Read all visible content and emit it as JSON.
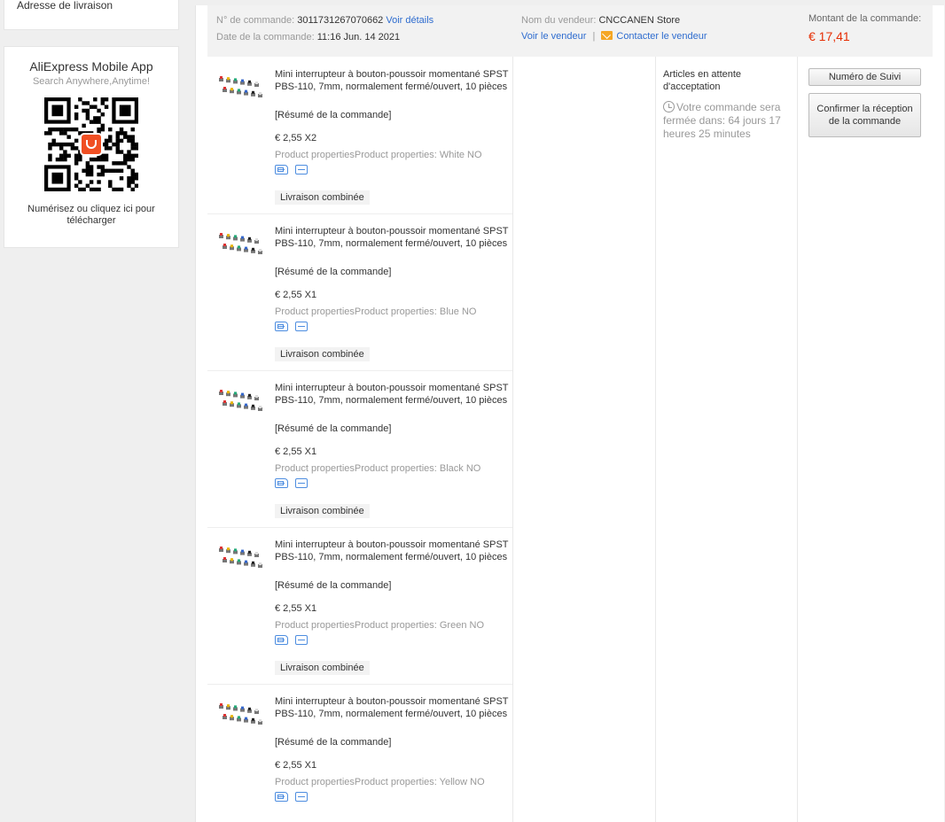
{
  "sidebar": {
    "address_label": "Adresse de livraison",
    "app_title": "AliExpress Mobile App",
    "app_subtitle": "Search Anywhere,Anytime!",
    "qr_logo_text": "AliExpress",
    "scan_text": "Numérisez ou cliquez ici pour télécharger"
  },
  "order": {
    "number_label": "N° de commande:",
    "number": "3011731267070662",
    "details_link": "Voir détails",
    "date_label": "Date de la commande:",
    "date": "11:16 Jun. 14 2021",
    "seller_label": "Nom du vendeur:",
    "seller": "CNCCANEN Store",
    "view_seller": "Voir le vendeur",
    "separator": "|",
    "contact_seller": "Contacter le vendeur",
    "amount_label": "Montant de la commande:",
    "amount": "€ 17,41",
    "status": "Articles en attente d'acceptation",
    "timer": "Votre commande sera fermée dans: 64 jours 17 heures 25 minutes",
    "track_button": "Numéro de Suivi",
    "confirm_button": "Confirmer la réception de la commande"
  },
  "items": [
    {
      "title": "Mini interrupteur à bouton-poussoir momentané SPST PBS-110, 7mm, normalement fermé/ouvert, 10 pièces",
      "summary": "[Résumé de la commande]",
      "price": "€ 2,55 X2",
      "props": "Product propertiesProduct properties: White NO",
      "combo": "Livraison combinée"
    },
    {
      "title": "Mini interrupteur à bouton-poussoir momentané SPST PBS-110, 7mm, normalement fermé/ouvert, 10 pièces",
      "summary": "[Résumé de la commande]",
      "price": "€ 2,55 X1",
      "props": "Product propertiesProduct properties: Blue NO",
      "combo": "Livraison combinée"
    },
    {
      "title": "Mini interrupteur à bouton-poussoir momentané SPST PBS-110, 7mm, normalement fermé/ouvert, 10 pièces",
      "summary": "[Résumé de la commande]",
      "price": "€ 2,55 X1",
      "props": "Product propertiesProduct properties: Black NO",
      "combo": "Livraison combinée"
    },
    {
      "title": "Mini interrupteur à bouton-poussoir momentané SPST PBS-110, 7mm, normalement fermé/ouvert, 10 pièces",
      "summary": "[Résumé de la commande]",
      "price": "€ 2,55 X1",
      "props": "Product propertiesProduct properties: Green NO",
      "combo": "Livraison combinée"
    },
    {
      "title": "Mini interrupteur à bouton-poussoir momentané SPST PBS-110, 7mm, normalement fermé/ouvert, 10 pièces",
      "summary": "[Résumé de la commande]",
      "price": "€ 2,55 X1",
      "props": "Product propertiesProduct properties: Yellow NO",
      "combo": ""
    }
  ],
  "icons": {
    "mail": "mail-icon",
    "clock": "clock-icon",
    "shipping": "shipping-icon",
    "snapshot": "snapshot-icon"
  },
  "colors": {
    "link": "#2e6ccf",
    "amount": "#e62e04",
    "brand": "#f04f23",
    "icon": "#4d8de0"
  }
}
